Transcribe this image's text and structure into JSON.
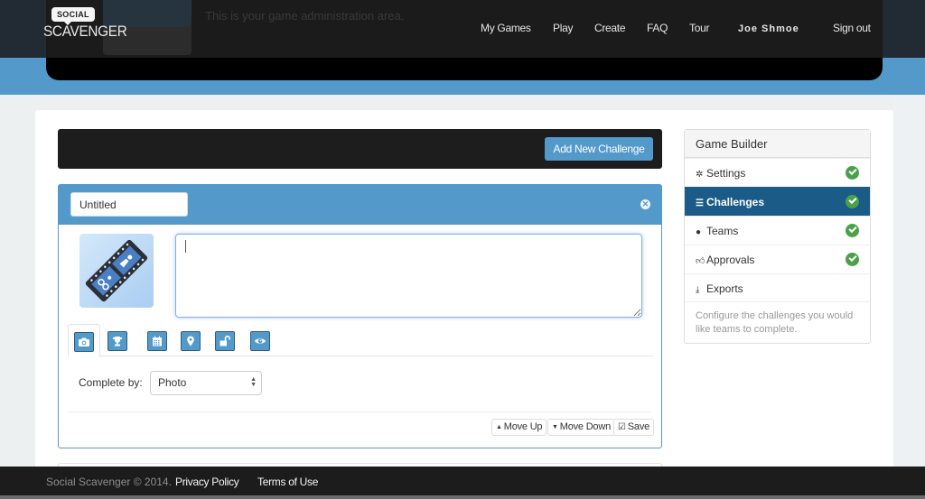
{
  "header": {
    "brand_top": "SOCIAL",
    "brand_bottom": "SCAVENGER",
    "admin_message": "This is your game administration area.",
    "nav": [
      {
        "label": "My Games"
      },
      {
        "label": "Play"
      },
      {
        "label": "Create"
      },
      {
        "label": "FAQ"
      },
      {
        "label": "Tour"
      }
    ],
    "user_name": "Joe Shmoe",
    "sign_out": "Sign out"
  },
  "toolbar": {
    "add_challenge_label": "Add New Challenge"
  },
  "challenge": {
    "title_value": "Untitled",
    "description_value": "",
    "thumbnail_icon": "film-strip-icon",
    "close_icon": "close-circle-icon",
    "tabs": [
      {
        "icon": "camera-icon",
        "active": true
      },
      {
        "icon": "trophy-icon",
        "active": false
      },
      {
        "icon": "calendar-icon",
        "active": false
      },
      {
        "icon": "map-marker-icon",
        "active": false
      },
      {
        "icon": "unlock-icon",
        "active": false
      },
      {
        "icon": "eye-icon",
        "active": false
      }
    ],
    "complete_by_label": "Complete by:",
    "complete_by_value": "Photo",
    "actions": {
      "move_up": "Move Up",
      "move_down": "Move Down",
      "save": "Save"
    }
  },
  "sidebar": {
    "title": "Game Builder",
    "items": [
      {
        "label": "Settings",
        "icon": "gear-icon",
        "complete": true,
        "active": false
      },
      {
        "label": "Challenges",
        "icon": "list-icon",
        "complete": true,
        "active": true
      },
      {
        "label": "Teams",
        "icon": "user-icon",
        "complete": true,
        "active": false
      },
      {
        "label": "Approvals",
        "icon": "thumbs-up-icon",
        "complete": true,
        "active": false
      },
      {
        "label": "Exports",
        "icon": "download-icon",
        "complete": false,
        "active": false
      }
    ],
    "help_text": "Configure the challenges you would like teams to complete."
  },
  "footer": {
    "copyright": "Social Scavenger © 2014.",
    "privacy": "Privacy Policy",
    "terms": "Terms of Use"
  },
  "colors": {
    "accent": "#539acb",
    "active_nav": "#1a5b87",
    "success": "#4aa14a",
    "dark": "#1b1b1b"
  }
}
